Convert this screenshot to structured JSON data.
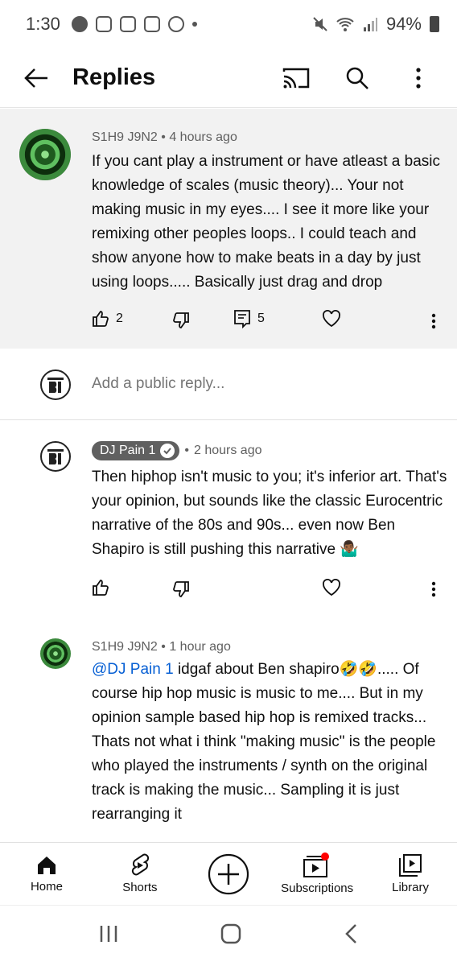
{
  "status_bar": {
    "time": "1:30",
    "battery": "94%"
  },
  "app_bar": {
    "title": "Replies"
  },
  "original_comment": {
    "author": "S1H9 J9N2",
    "time": "4 hours ago",
    "text": "If you cant play a instrument or have atleast a basic knowledge of scales (music theory)... Your not making music in my eyes.... I see it more like your remixing other peoples loops.. I could teach and show anyone how to make beats in a day by just using loops..... Basically just drag and drop",
    "likes": "2",
    "replies": "5"
  },
  "add_reply": {
    "placeholder": "Add a public reply..."
  },
  "replies": [
    {
      "author": "DJ Pain 1",
      "time": "2 hours ago",
      "text": "Then hiphop isn't music to you; it's inferior art. That's your opinion, but sounds like the classic Eurocentric narrative of the 80s and 90s... even now Ben Shapiro is still pushing this narrative 🤷🏾‍♂️"
    },
    {
      "author": "S1H9 J9N2",
      "time": "1 hour ago",
      "mention": "@DJ Pain 1",
      "text": " idgaf about Ben shapiro🤣🤣..... Of course hip hop music is music to me.... But in my opinion sample based hip hop is remixed tracks... Thats not what i think \"making music\" is the people who played the instruments / synth on the original track is making the music... Sampling it is just rearranging it"
    }
  ],
  "bottom_nav": {
    "home": "Home",
    "shorts": "Shorts",
    "subscriptions": "Subscriptions",
    "library": "Library"
  },
  "colors": {
    "accent_red": "#ff0000",
    "mention_blue": "#065fd4",
    "highlight_bg": "#f2f2f2"
  }
}
